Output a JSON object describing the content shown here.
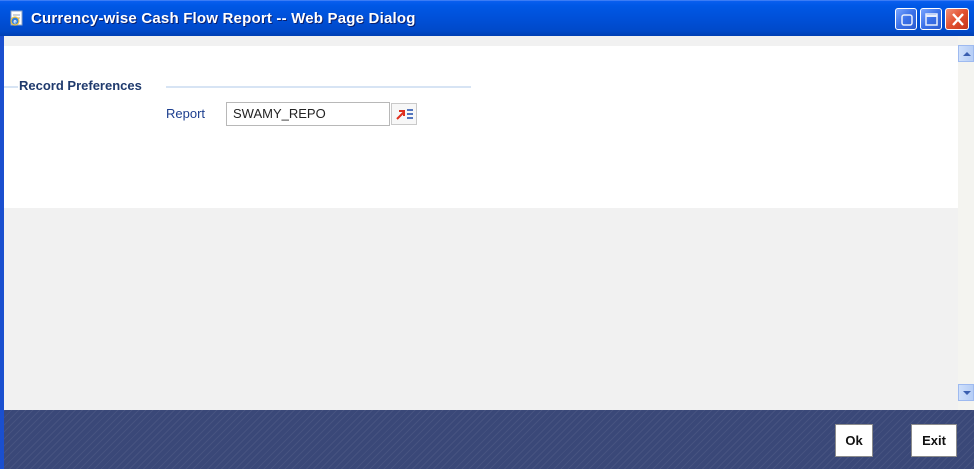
{
  "window": {
    "title": "Currency-wise Cash Flow Report -- Web Page Dialog",
    "icon": "ie-page-icon",
    "controls": [
      "help-icon",
      "maximize-icon",
      "close-icon"
    ]
  },
  "form": {
    "section_title": "Record Preferences",
    "report_label": "Report",
    "report_value": "SWAMY_REPO",
    "lov_icon": "list-of-values-icon"
  },
  "footer": {
    "ok_label": "Ok",
    "exit_label": "Exit"
  },
  "colors": {
    "titlebar": "#0050d8",
    "footer": "#3a4878",
    "section_text": "#1f3a6d",
    "field_label": "#1d3f8f",
    "lov_arrow": "#e0301e"
  }
}
